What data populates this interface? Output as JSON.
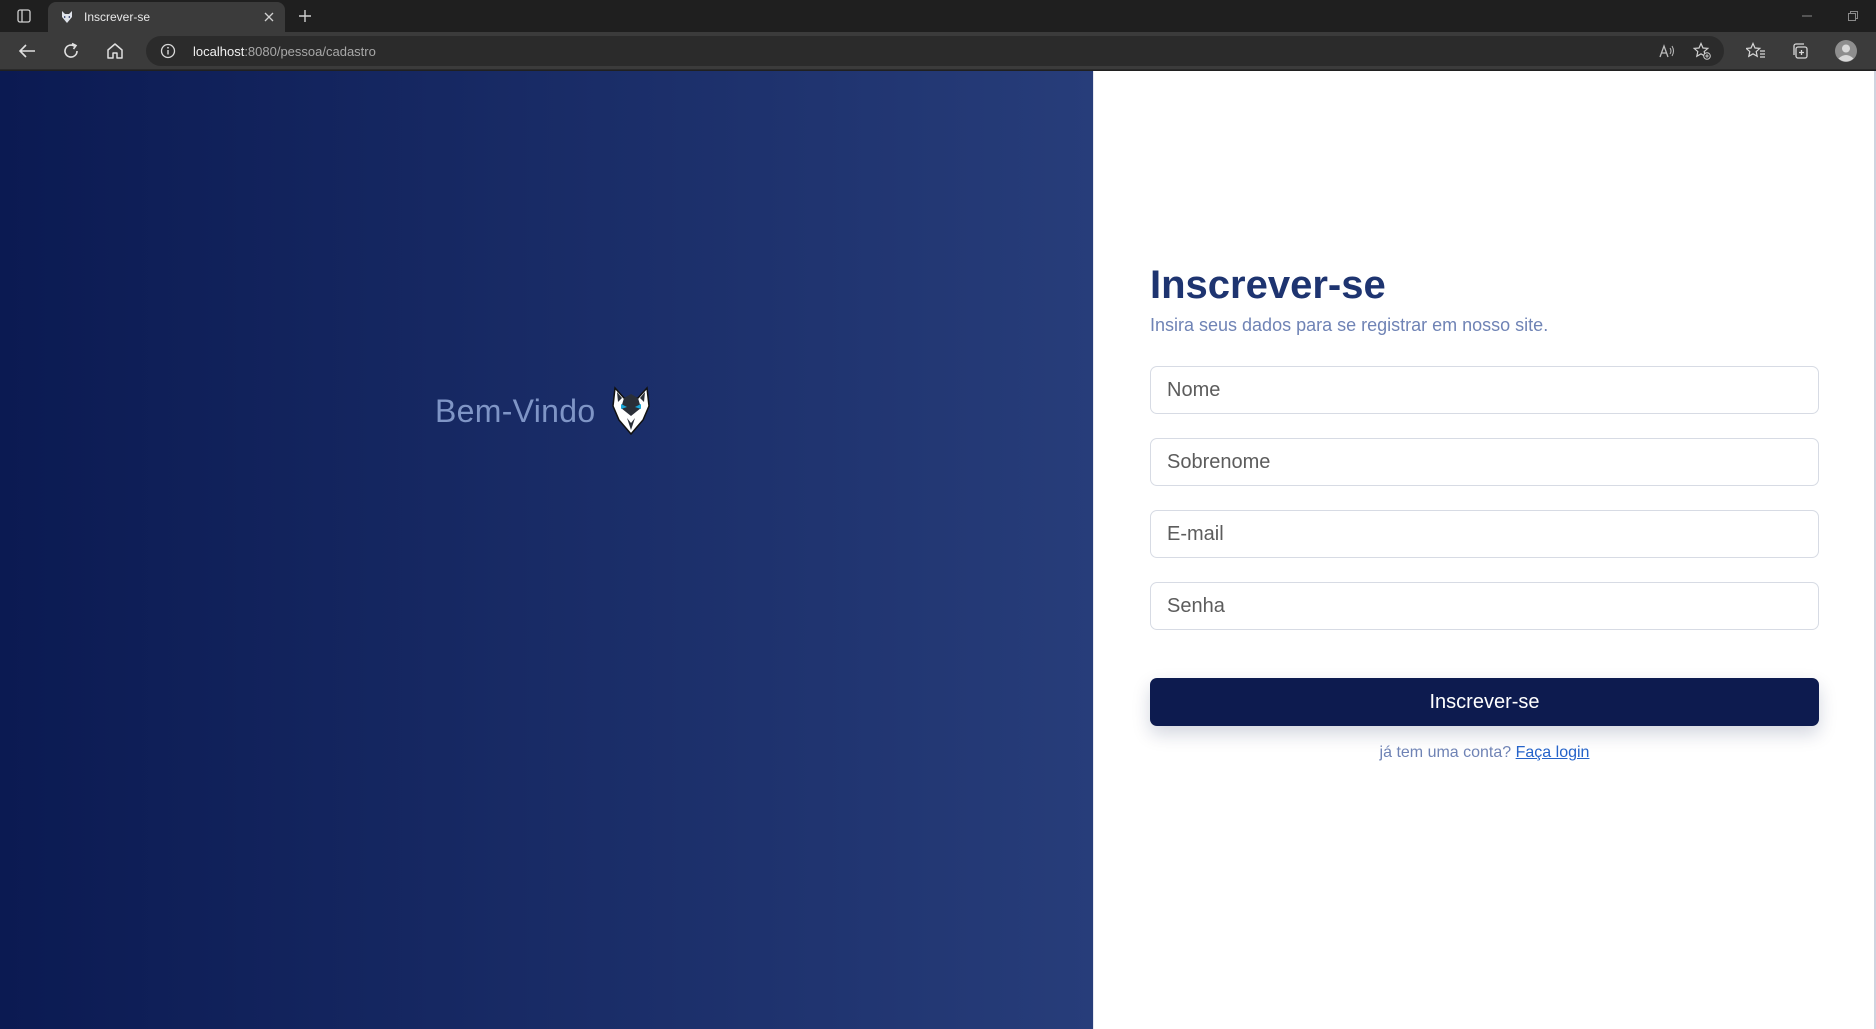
{
  "browser": {
    "tab_title": "Inscrever-se",
    "url_host": "localhost",
    "url_path": ":8080/pessoa/cadastro"
  },
  "left": {
    "welcome": "Bem-Vindo"
  },
  "form": {
    "title": "Inscrever-se",
    "subtitle": "Insira seus dados para se registrar em nosso site.",
    "fields": [
      {
        "placeholder": "Nome",
        "value": ""
      },
      {
        "placeholder": "Sobrenome",
        "value": ""
      },
      {
        "placeholder": "E-mail",
        "value": ""
      },
      {
        "placeholder": "Senha",
        "value": ""
      }
    ],
    "submit_label": "Inscrever-se",
    "login_prompt": "já tem uma conta?",
    "login_link": "Faça login"
  },
  "colors": {
    "primary": "#0d1b4f",
    "title": "#1e3470",
    "muted": "#6f83b5",
    "link": "#2563c9",
    "gradient_start": "#0b1a52",
    "gradient_end": "#273d7a"
  },
  "icons": {
    "tab_actions": "tab-actions-icon",
    "favicon": "wolf-icon",
    "close": "close-icon",
    "new_tab": "plus-icon",
    "back": "back-arrow-icon",
    "refresh": "refresh-icon",
    "home": "home-icon",
    "site_info": "info-icon",
    "read_aloud": "read-aloud-icon",
    "add_favorite": "star-add-icon",
    "favorites": "favorites-icon",
    "collections": "collections-icon",
    "profile": "profile-icon"
  }
}
